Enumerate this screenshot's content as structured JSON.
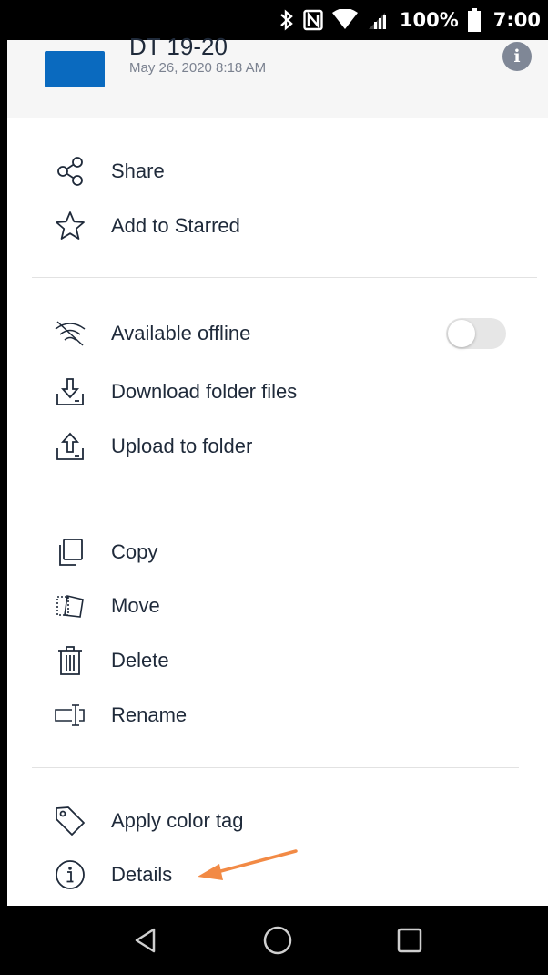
{
  "status_bar": {
    "battery": "100%",
    "time": "7:00",
    "icons": [
      "bluetooth-icon",
      "nfc-icon",
      "wifi-icon",
      "signal-icon",
      "battery-icon"
    ]
  },
  "header": {
    "folder_name": "DT 19-20",
    "date": "May 26, 2020 8:18 AM",
    "folder_color": "#0a6abf"
  },
  "menu": {
    "share": "Share",
    "starred": "Add to Starred",
    "offline": "Available offline",
    "offline_enabled": false,
    "download": "Download folder files",
    "upload": "Upload to folder",
    "copy": "Copy",
    "move": "Move",
    "delete": "Delete",
    "rename": "Rename",
    "color_tag": "Apply color tag",
    "details": "Details"
  },
  "annotation": {
    "arrow_color": "#f28a45"
  },
  "nav_bar": {
    "buttons": [
      "back-icon",
      "home-icon",
      "recents-icon"
    ]
  }
}
